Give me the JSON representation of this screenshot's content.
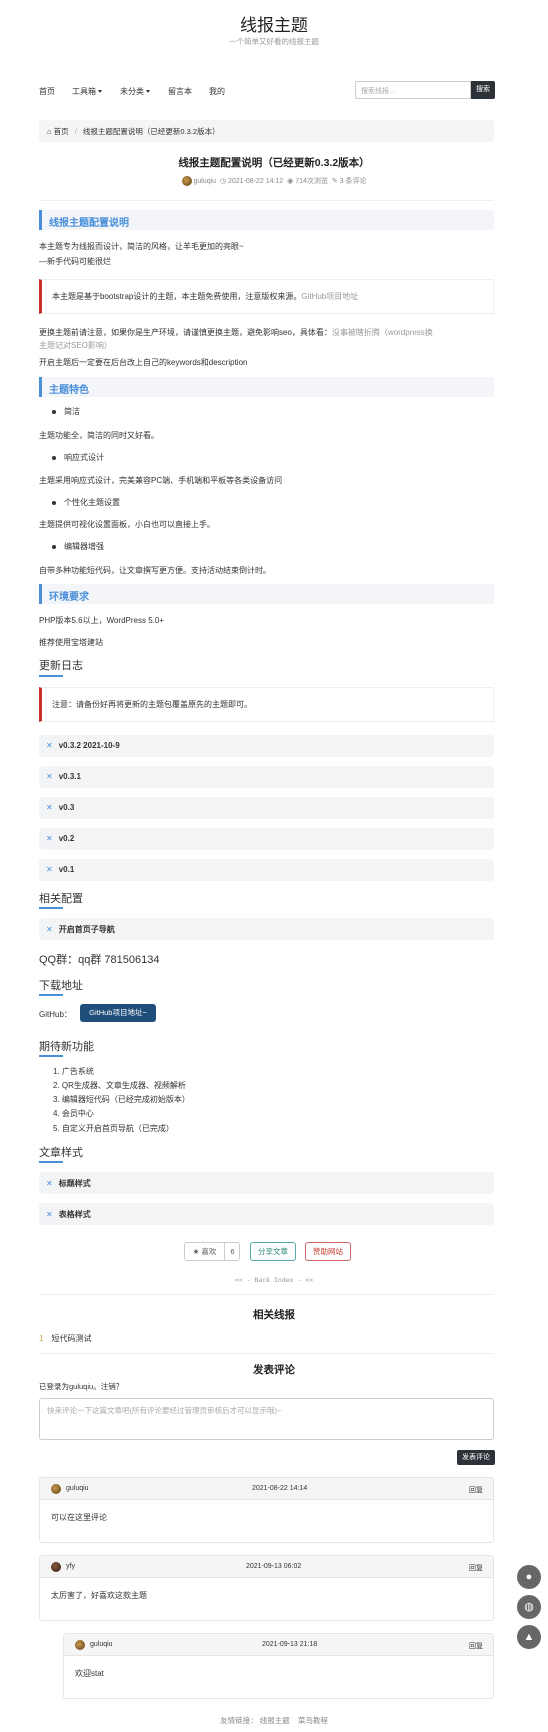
{
  "site": {
    "title": "线报主题",
    "subtitle": "一个简单又好看的线报主题"
  },
  "nav": {
    "items": [
      "首页",
      "工具箱",
      "未分类",
      "留言本",
      "我的"
    ],
    "search_placeholder": "搜索线报...",
    "search_button": "搜索"
  },
  "breadcrumb": {
    "home": "首页",
    "separator": "/",
    "current": "线报主题配置说明（已经更新0.3.2版本）"
  },
  "post": {
    "title": "线报主题配置说明（已经更新0.3.2版本）",
    "author": "guluqiu",
    "date": "2021-08-22 14:12",
    "views": "714次浏览",
    "comments": "3 条评论"
  },
  "content": {
    "h_config": "线报主题配置说明",
    "p1": "本主题专为线报而设计，简洁的风格，让羊毛更加的亮眼~",
    "p2": "—新手代码可能很烂",
    "quote1_text": "本主题是基于bootstrap设计的主题，本主题免费使用，注意版权来源。",
    "quote1_link": "GitHub项目地址",
    "p3_text": "更换主题前请注意，如果你是生产环境，请谨慎更换主题，避免影响seo，具体看：",
    "p3_link_a": "没事被瞎折腾（wordpress换",
    "p3_link_b": "主题记对SEO影响）",
    "p4": "开启主题后一定要在后台改上自己的keywords和description",
    "h_features": "主题特色",
    "f1_item": "简洁",
    "f1_desc": "主题功能全，简洁的同时又好看。",
    "f2_item": "响应式设计",
    "f2_desc": "主题采用响应式设计，完美兼容PC端、手机端和平板等各类设备访问",
    "f3_item": "个性化主题设置",
    "f3_desc": "主题提供可视化设置面板，小白也可以直接上手。",
    "f4_item": "编辑器增强",
    "f4_desc": "自带多种功能短代码，让文章撰写更方便。支持活动结束倒计时。",
    "h_env": "环境要求",
    "env1": "PHP版本5.6以上，WordPress 5.0+",
    "env2": "推荐使用宝塔建站",
    "h_changelog": "更新日志",
    "quote2": "注意：请备份好再将更新的主题包覆盖原先的主题即可。",
    "changelog": [
      "v0.3.2 2021-10-9",
      "v0.3.1",
      "v0.3",
      "v0.2",
      "v0.1"
    ],
    "h_related_config": "相关配置",
    "related_config_item": "开启首页子导航",
    "qq": "QQ群：qq群 781506134",
    "h_download": "下载地址",
    "github_label": "GitHub：",
    "github_button": "GitHub项目地址~",
    "h_expect": "期待新功能",
    "expect": [
      "1. 广告系统",
      "2. QR生成器、文章生成器、视频解析",
      "3. 编辑器短代码（已经完成初始版本）",
      "4. 会员中心",
      "5. 自定义开启首页导航（已完成）"
    ],
    "h_style": "文章样式",
    "style_items": [
      "标题样式",
      "表格样式"
    ]
  },
  "actions": {
    "like": "喜欢",
    "like_count": "6",
    "share": "分享文章",
    "donate": "赞助网站",
    "back_index": "<< - Back Index - >>"
  },
  "related": {
    "title": "相关线报",
    "items": [
      {
        "num": "1",
        "label": "短代码测试"
      }
    ]
  },
  "comments_section": {
    "title": "发表评论",
    "logged_in": "已登录为guluqiu。注销？",
    "placeholder": "快来评论一下这篇文章吧(所有评论要经过管理员审核后才可以显示哦)~",
    "submit": "发表评论",
    "list": [
      {
        "author": "guluqiu",
        "date": "2021-08-22 14:14",
        "reply": "回复",
        "text": "可以在这里评论"
      },
      {
        "author": "yfy",
        "date": "2021-09-13 06:02",
        "reply": "回复",
        "text": "太厉害了，好喜欢这款主题"
      },
      {
        "author": "guluqiu",
        "date": "2021-09-13 21:18",
        "reply": "回复",
        "text": "欢迎stat"
      }
    ]
  },
  "footer": {
    "label": "友情链接：",
    "links": [
      "线报主题",
      "菜鸟教程"
    ]
  },
  "colors": {
    "accent": "#4a90d9",
    "quote_border": "#c9302c",
    "dark_button": "#2d3238",
    "github_button": "#1f4e7a"
  }
}
